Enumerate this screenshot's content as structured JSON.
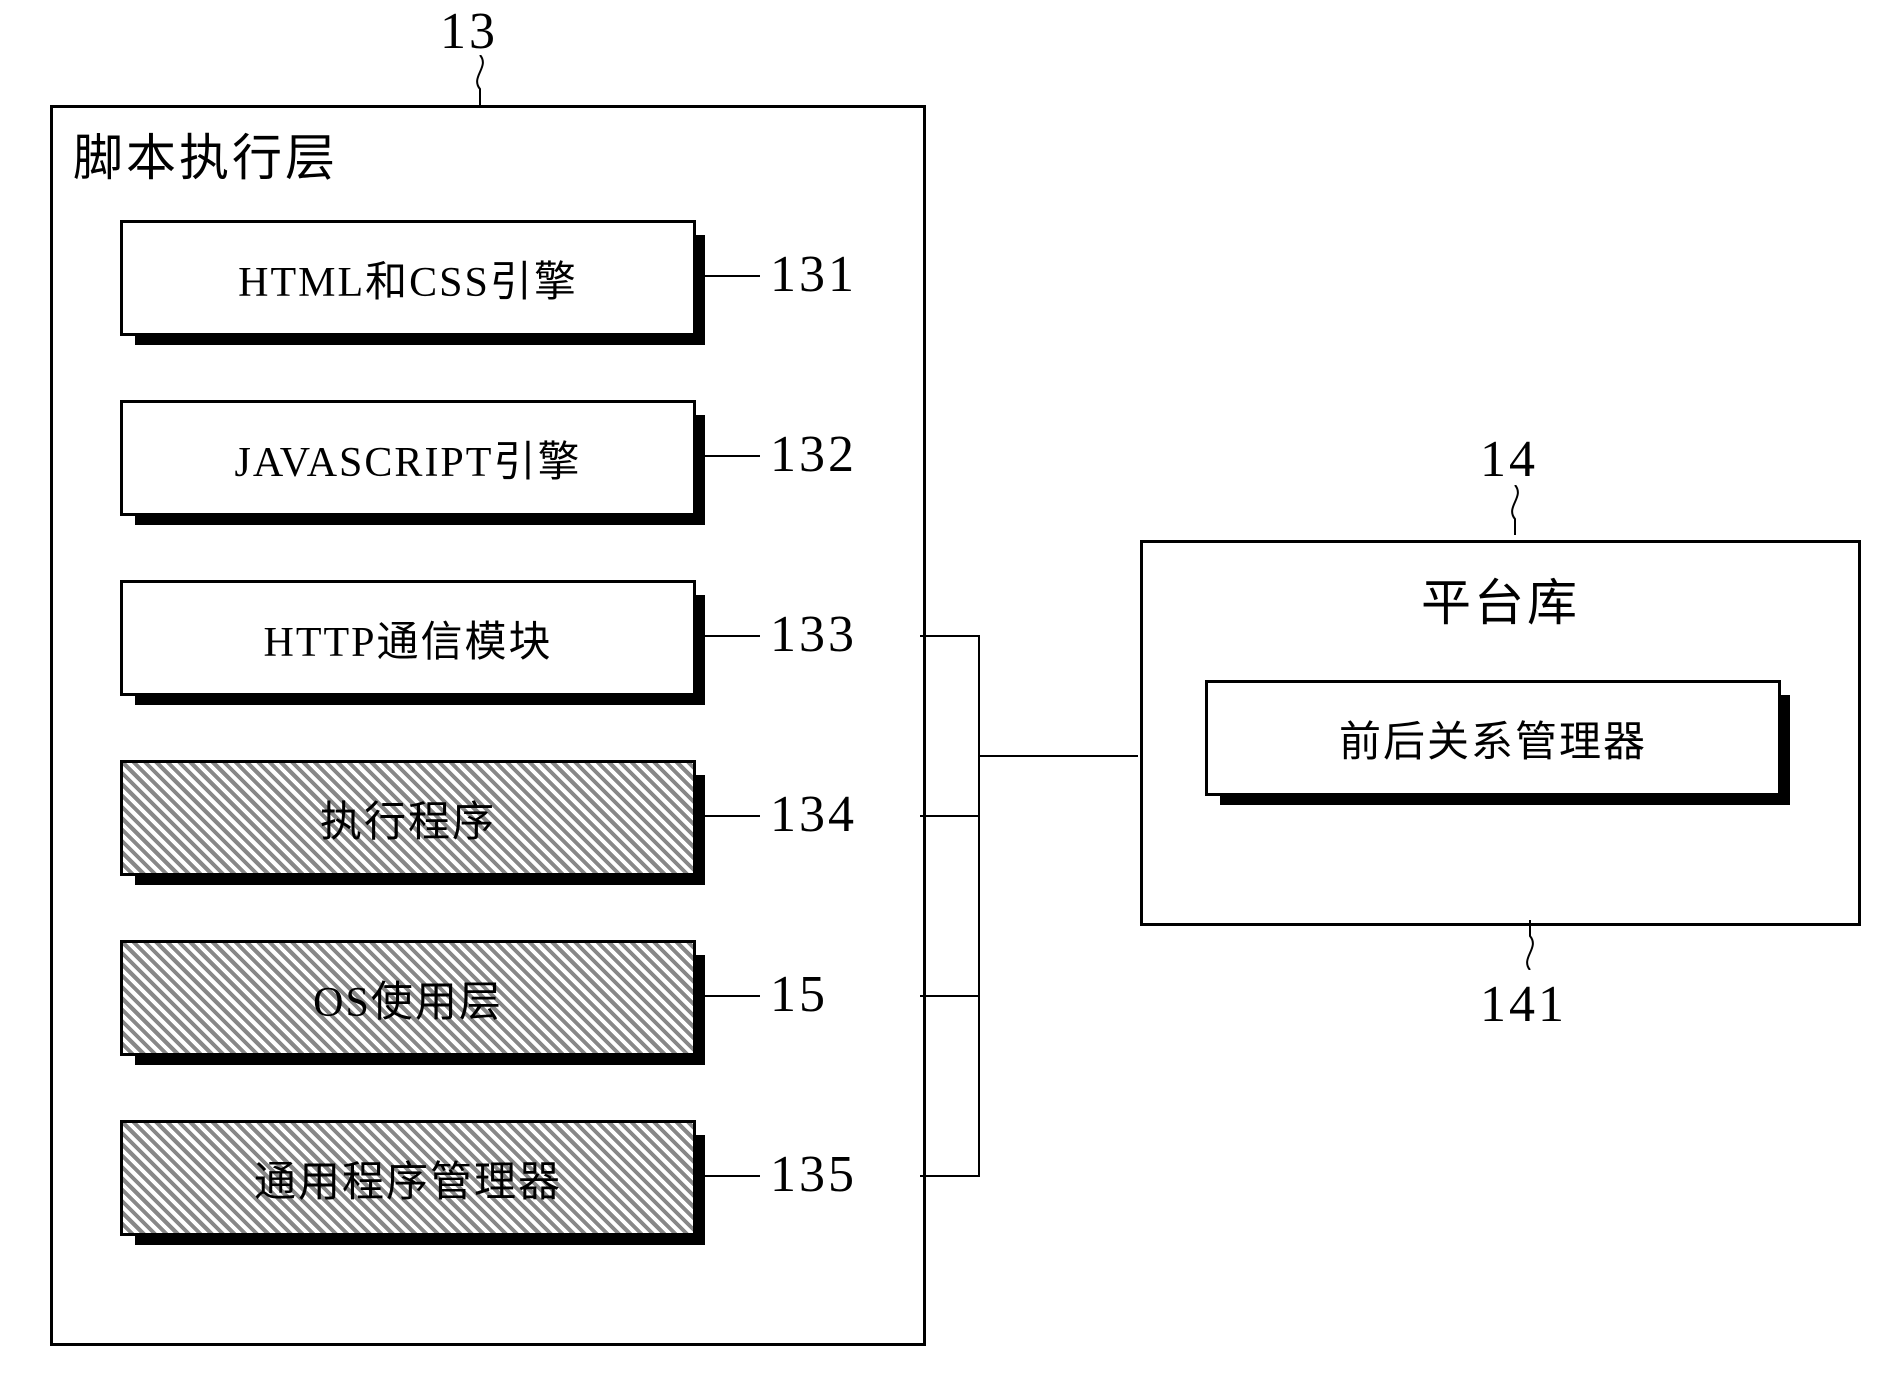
{
  "left_box": {
    "ref": "13",
    "title": "脚本执行层",
    "items": [
      {
        "label": "HTML和CSS引擎",
        "ref": "131",
        "hatched": false
      },
      {
        "label": "JAVASCRIPT引擎",
        "ref": "132",
        "hatched": false
      },
      {
        "label": "HTTP通信模块",
        "ref": "133",
        "hatched": false
      },
      {
        "label": "执行程序",
        "ref": "134",
        "hatched": true
      },
      {
        "label": "OS使用层",
        "ref": "15",
        "hatched": true
      },
      {
        "label": "通用程序管理器",
        "ref": "135",
        "hatched": true
      }
    ]
  },
  "right_box": {
    "ref": "14",
    "title": "平台库",
    "inner": {
      "label": "前后关系管理器",
      "ref": "141"
    }
  }
}
